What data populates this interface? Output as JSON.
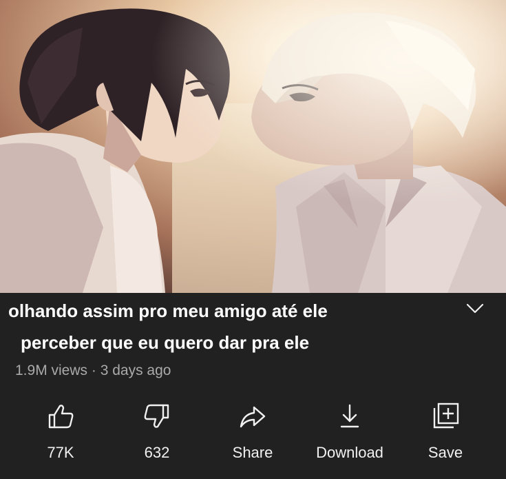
{
  "video": {
    "title_line1": "olhando assim pro meu amigo até ele",
    "title_line2": "perceber que eu quero dar pra ele",
    "meta": "1.9M views · 3 days ago"
  },
  "actions": {
    "like_label": "77K",
    "dislike_label": "632",
    "share_label": "Share",
    "download_label": "Download",
    "save_label": "Save"
  },
  "icons": {
    "expand": "chevron-down-icon",
    "like": "thumbs-up-icon",
    "dislike": "thumbs-down-icon",
    "share": "share-arrow-icon",
    "download": "download-icon",
    "save": "playlist-add-icon"
  },
  "colors": {
    "background": "#212121",
    "title": "#ffffff",
    "meta": "#aaaaaa",
    "action_label": "#f1f1f1"
  }
}
